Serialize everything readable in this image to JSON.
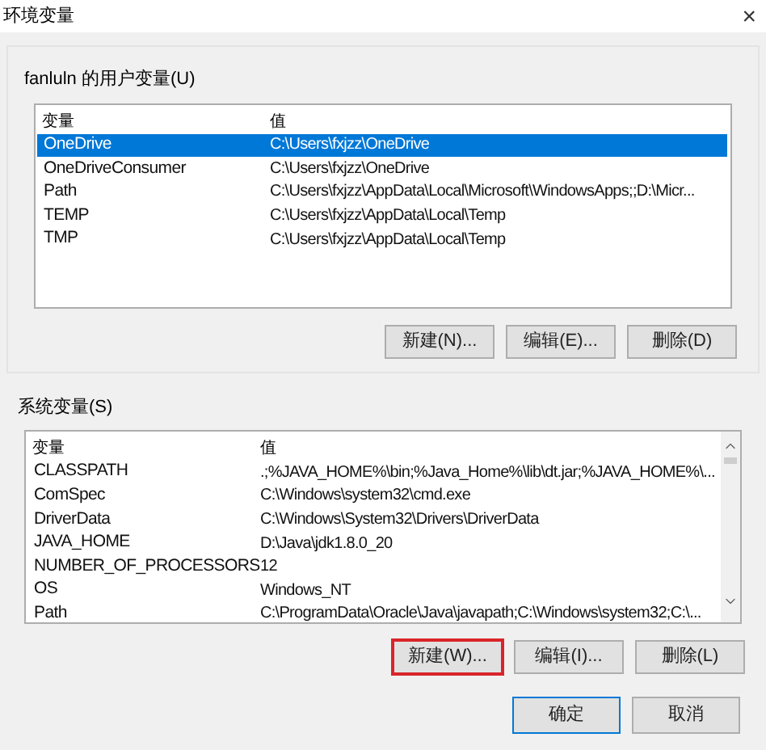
{
  "window": {
    "title": "环境变量",
    "close": "×"
  },
  "user_vars": {
    "label": "fanluln 的用户变量(U)",
    "columns": [
      "变量",
      "值"
    ],
    "rows": [
      {
        "name": "OneDrive",
        "value": "C:\\Users\\fxjzz\\OneDrive",
        "selected": true
      },
      {
        "name": "OneDriveConsumer",
        "value": "C:\\Users\\fxjzz\\OneDrive",
        "selected": false
      },
      {
        "name": "Path",
        "value": "C:\\Users\\fxjzz\\AppData\\Local\\Microsoft\\WindowsApps;;D:\\Micr...",
        "selected": false
      },
      {
        "name": "TEMP",
        "value": "C:\\Users\\fxjzz\\AppData\\Local\\Temp",
        "selected": false
      },
      {
        "name": "TMP",
        "value": "C:\\Users\\fxjzz\\AppData\\Local\\Temp",
        "selected": false
      }
    ],
    "buttons": [
      {
        "label": "新建(N)...",
        "highlighted": false
      },
      {
        "label": "编辑(E)...",
        "highlighted": false
      },
      {
        "label": "删除(D)",
        "highlighted": false
      }
    ]
  },
  "system_vars": {
    "label": "系统变量(S)",
    "columns": [
      "变量",
      "值"
    ],
    "rows": [
      {
        "name": "CLASSPATH",
        "value": ".;%JAVA_HOME%\\bin;%Java_Home%\\lib\\dt.jar;%JAVA_HOME%\\...",
        "selected": false
      },
      {
        "name": "ComSpec",
        "value": "C:\\Windows\\system32\\cmd.exe",
        "selected": false
      },
      {
        "name": "DriverData",
        "value": "C:\\Windows\\System32\\Drivers\\DriverData",
        "selected": false
      },
      {
        "name": "JAVA_HOME",
        "value": "D:\\Java\\jdk1.8.0_20",
        "selected": false
      },
      {
        "name": "NUMBER_OF_PROCESSORS",
        "value": "12",
        "selected": false
      },
      {
        "name": "OS",
        "value": "Windows_NT",
        "selected": false
      },
      {
        "name": "Path",
        "value": "C:\\ProgramData\\Oracle\\Java\\javapath;C:\\Windows\\system32;C:\\...",
        "selected": false
      }
    ],
    "buttons": [
      {
        "label": "新建(W)...",
        "highlighted": true
      },
      {
        "label": "编辑(I)...",
        "highlighted": false
      },
      {
        "label": "删除(L)",
        "highlighted": false
      }
    ]
  },
  "footer_buttons": [
    {
      "label": "确定",
      "default": true
    },
    {
      "label": "取消",
      "default": false
    }
  ]
}
